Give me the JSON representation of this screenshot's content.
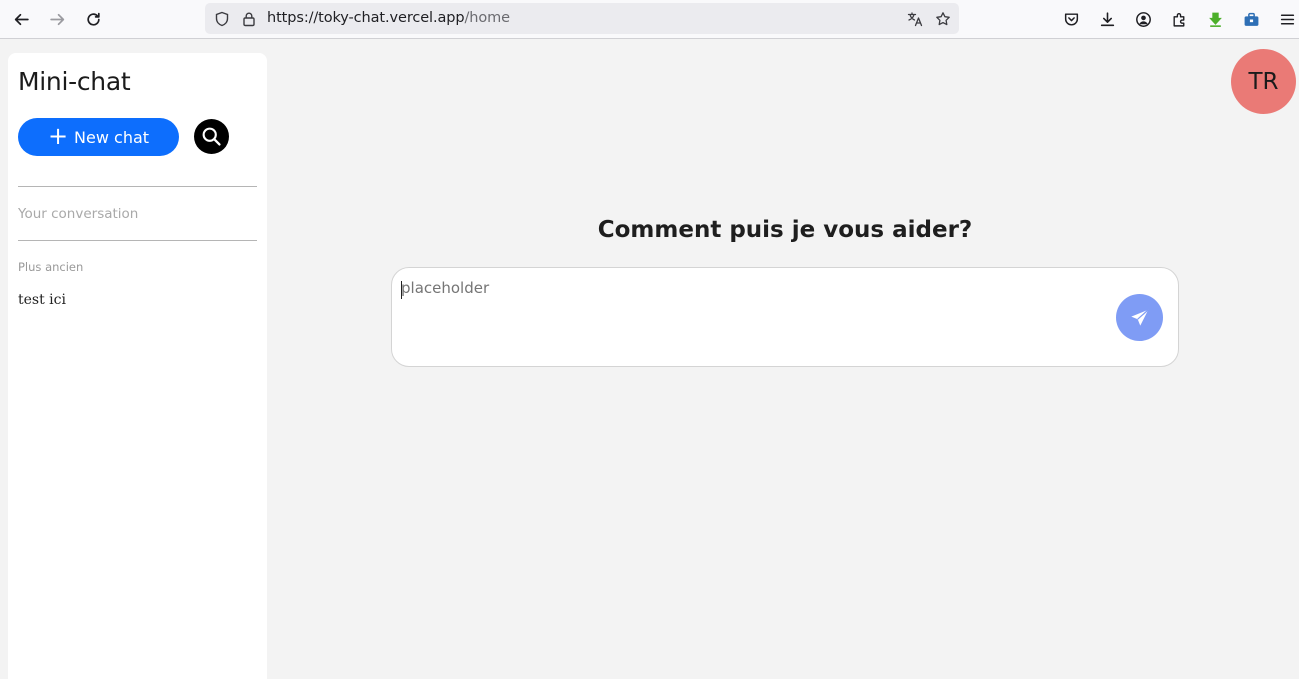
{
  "browser": {
    "url_main": "https://toky-chat.vercel.app",
    "url_path": "/home"
  },
  "sidebar": {
    "title": "Mini-chat",
    "new_chat_label": "New chat",
    "conversation_label": "Your conversation",
    "section_label": "Plus ancien",
    "items": [
      {
        "label": "test ici"
      }
    ]
  },
  "user": {
    "initials": "TR",
    "avatar_color": "#ea7a76"
  },
  "main": {
    "headline": "Comment puis je vous aider?",
    "input_placeholder": "placeholder",
    "input_value": ""
  },
  "colors": {
    "accent": "#0d6efd",
    "send": "#7f9cf5"
  }
}
